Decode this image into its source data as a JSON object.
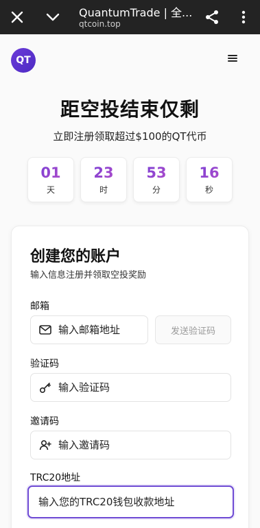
{
  "browser": {
    "title": "QuantumTrade | 全...",
    "url": "qtcoin.top"
  },
  "header": {
    "logo_text": "QT"
  },
  "hero": {
    "title": "距空投结束仅剩",
    "subtitle": "立即注册领取超过$100的QT代币"
  },
  "countdown": [
    {
      "value": "01",
      "unit": "天"
    },
    {
      "value": "23",
      "unit": "时"
    },
    {
      "value": "53",
      "unit": "分"
    },
    {
      "value": "16",
      "unit": "秒"
    }
  ],
  "form": {
    "title": "创建您的账户",
    "subtitle": "输入信息注册并领取空投奖励",
    "email": {
      "label": "邮箱",
      "placeholder": "输入邮箱地址",
      "icon": "mail-icon"
    },
    "send_code_label": "发送验证码",
    "code": {
      "label": "验证码",
      "placeholder": "输入验证码",
      "icon": "key-icon"
    },
    "invite": {
      "label": "邀请码",
      "placeholder": "输入邀请码",
      "icon": "user-plus-icon"
    },
    "trc20": {
      "label": "TRC20地址",
      "placeholder": "输入您的TRC20钱包收款地址"
    }
  },
  "colors": {
    "accent": "#6e4ad4",
    "gradient_start": "#6a3bd8",
    "gradient_end": "#c050c6",
    "chrome_bg": "#232323"
  }
}
